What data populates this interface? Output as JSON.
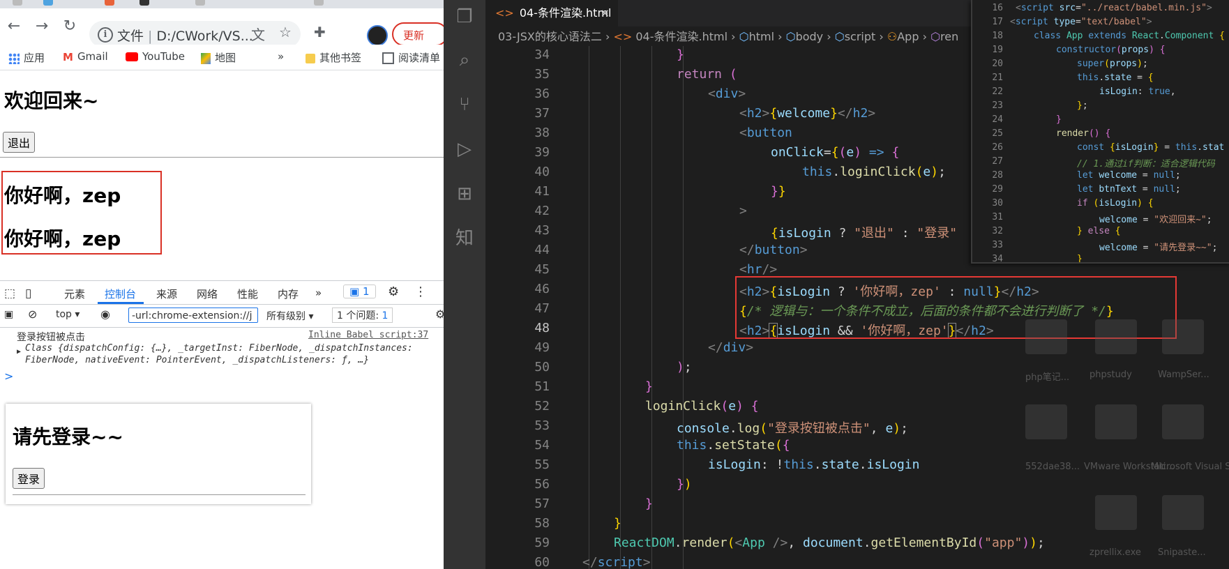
{
  "browser": {
    "address": {
      "label": "文件",
      "path": "D:/CWork/VS..."
    },
    "update_label": "更新",
    "bookmarks": [
      {
        "label": "应用",
        "icon": "apps-icon"
      },
      {
        "label": "Gmail",
        "icon": "gmail-icon"
      },
      {
        "label": "YouTube",
        "icon": "youtube-icon"
      },
      {
        "label": "地图",
        "icon": "maps-icon"
      },
      {
        "label": "其他书签",
        "icon": "folder-icon"
      },
      {
        "label": "阅读清单",
        "icon": "reading-list-icon"
      }
    ],
    "more_label": "»",
    "page": {
      "welcome": "欢迎回来~",
      "logout_btn": "退出",
      "hello1": "你好啊，zep",
      "hello2": "你好啊，zep"
    },
    "devtools": {
      "tabs": [
        "元素",
        "控制台",
        "来源",
        "网络",
        "性能",
        "内存"
      ],
      "issue_badge": "1",
      "context": "top",
      "filter": "-url:chrome-extension://j",
      "level": "所有级别",
      "issues_label": "1 个问题:",
      "issues_count": "1",
      "log_message": "登录按钮被点击",
      "log_source": "Inline Babel script:37",
      "log_detail": "Class {dispatchConfig: {…}, _targetInst: FiberNode, _dispatchInstances: FiberNode, nativeEvent: PointerEvent, _dispatchListeners: ƒ, …}",
      "prompt": ">"
    },
    "popup": {
      "title": "请先登录~~",
      "login_btn": "登录"
    }
  },
  "editor": {
    "tab": "04-条件渲染.html",
    "breadcrumb": [
      "03-JSX的核心语法二",
      "04-条件渲染.html",
      "html",
      "body",
      "script",
      "App",
      "ren"
    ],
    "line_numbers": [
      "34",
      "35",
      "36",
      "37",
      "38",
      "39",
      "40",
      "41",
      "42",
      "43",
      "44",
      "45",
      "46",
      "47",
      "48",
      "49",
      "50",
      "51",
      "52",
      "53",
      "54",
      "55",
      "56",
      "57",
      "58",
      "59",
      "60"
    ],
    "current_line": "48"
  },
  "peek": {
    "line_numbers": [
      "16",
      "17",
      "18",
      "19",
      "20",
      "21",
      "22",
      "23",
      "24",
      "25",
      "26",
      "27",
      "28",
      "29",
      "30",
      "31",
      "32",
      "33",
      "34"
    ]
  },
  "desktop_icons": [
    "php笔记...",
    "phpstudy",
    "WampSer...",
    "552dae38...",
    "VMware Workstati...",
    "Microsoft Visual Stu...",
    "zprellix.exe",
    "Snipaste..."
  ]
}
